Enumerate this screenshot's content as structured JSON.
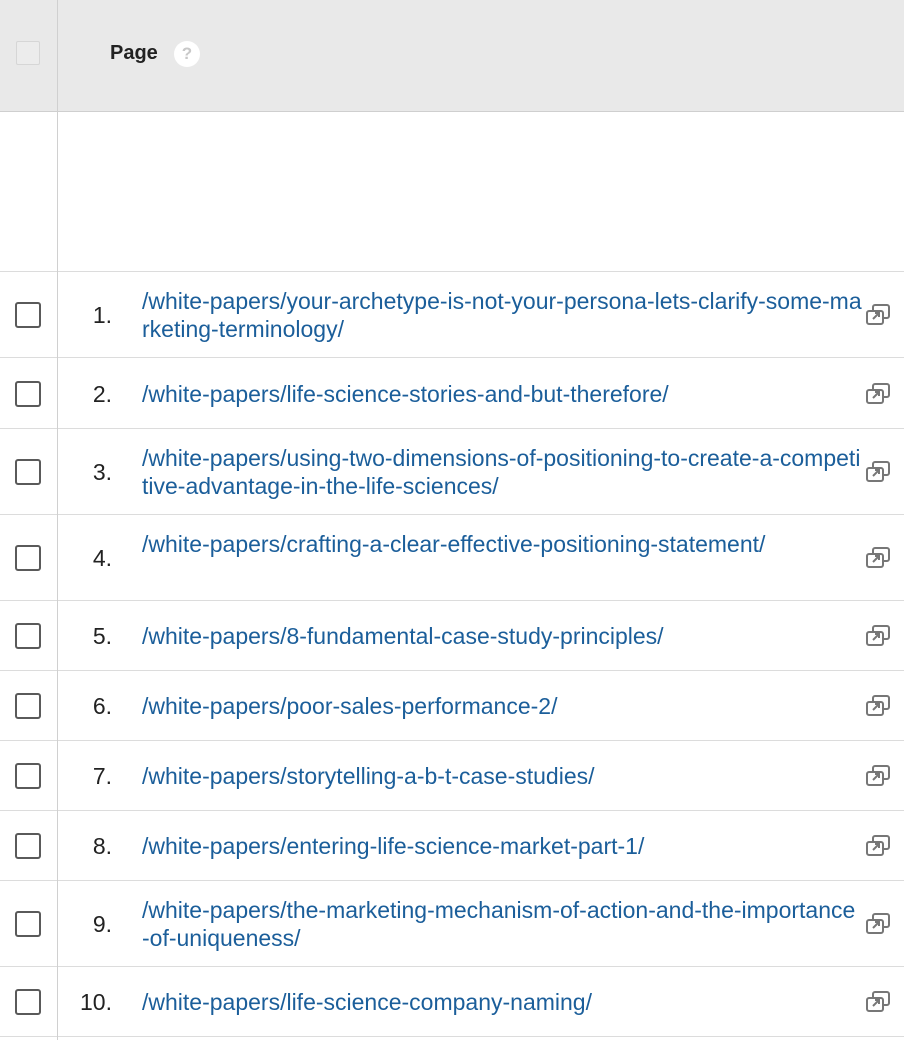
{
  "header": {
    "column_title": "Page",
    "help_glyph": "?"
  },
  "rows": [
    {
      "num": "1.",
      "url": "/white-papers/your-archetype-is-not-your-persona-lets-clarify-some-marketing-terminology/"
    },
    {
      "num": "2.",
      "url": "/white-papers/life-science-stories-and-but-therefore/"
    },
    {
      "num": "3.",
      "url": "/white-papers/using-two-dimensions-of-positioning-to-create-a-competitive-advantage-in-the-life-sciences/"
    },
    {
      "num": "4.",
      "url": "/white-papers/crafting-a-clear-effective-positioning-statement/"
    },
    {
      "num": "5.",
      "url": "/white-papers/8-fundamental-case-study-principles/"
    },
    {
      "num": "6.",
      "url": "/white-papers/poor-sales-performance-2/"
    },
    {
      "num": "7.",
      "url": "/white-papers/storytelling-a-b-t-case-studies/"
    },
    {
      "num": "8.",
      "url": "/white-papers/entering-life-science-market-part-1/"
    },
    {
      "num": "9.",
      "url": "/white-papers/the-marketing-mechanism-of-action-and-the-importance-of-uniqueness/"
    },
    {
      "num": "10.",
      "url": "/white-papers/life-science-company-naming/"
    }
  ],
  "icons": {
    "row_link_icon": "open-in-new-window-icon",
    "help_icon": "question-circle-icon"
  },
  "colors": {
    "link": "#1b5e9a",
    "header_bg": "#e9e9e9",
    "border": "#dcdcdc"
  }
}
